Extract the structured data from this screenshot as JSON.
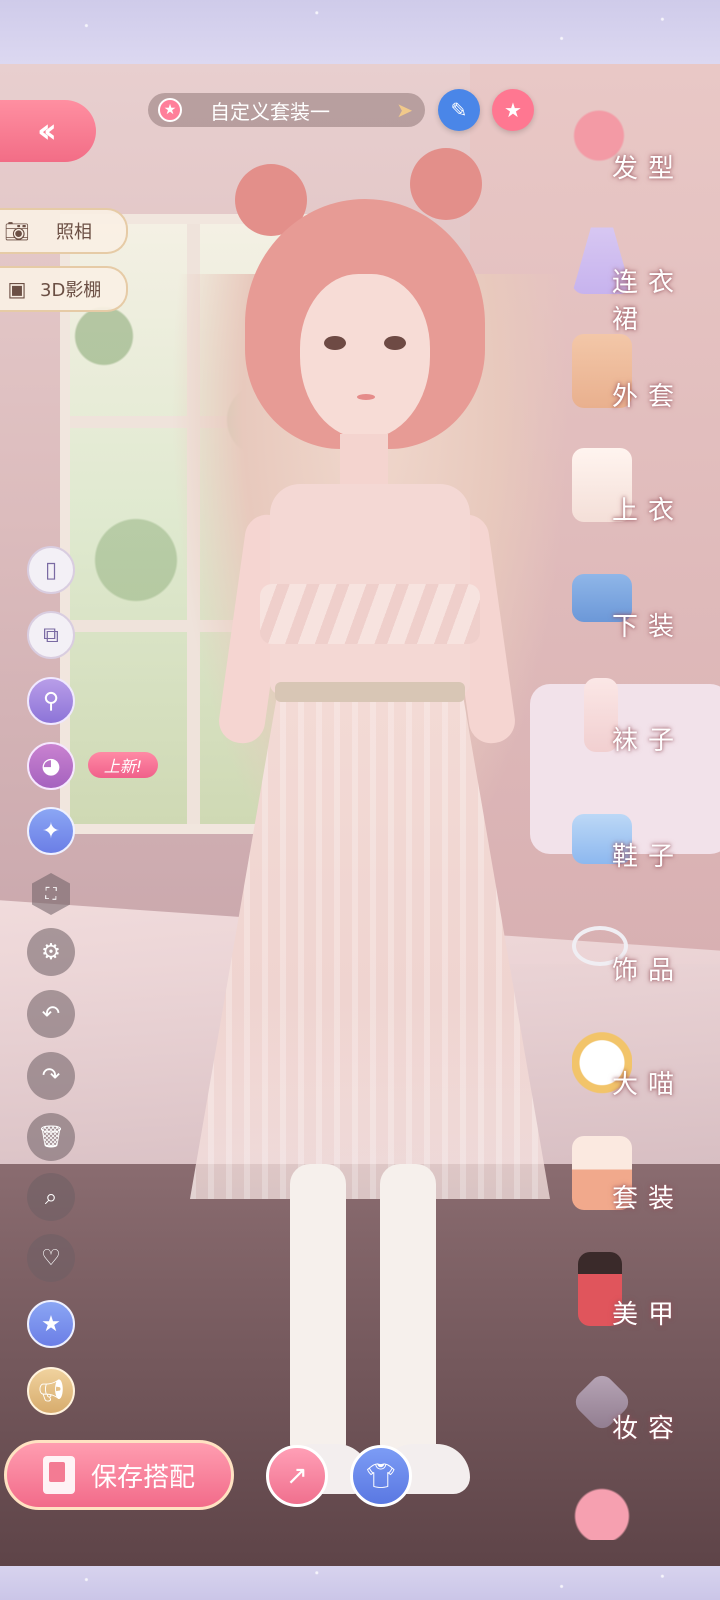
{
  "top_bar": {
    "outfit_name": "自定义套装一",
    "back_icon": "double-chevron-left-icon",
    "edit_icon": "pencil-icon",
    "favorite_icon": "star-icon"
  },
  "left_actions": {
    "photo_label": "照相",
    "studio_label": "3D影棚"
  },
  "left_tools": {
    "new_badge": "上新!",
    "icons": [
      "phone-icon",
      "add-layer-icon",
      "search-swap-icon",
      "palette-icon",
      "sparkle-star-icon",
      "fullscreen-icon",
      "settings-icon",
      "undo-icon",
      "redo-icon",
      "trash-icon",
      "search-icon",
      "heart-icon",
      "star-icon",
      "megaphone-icon"
    ]
  },
  "categories": [
    {
      "label": "发型",
      "icon": "hair-icon"
    },
    {
      "label": "连衣裙",
      "icon": "dress-icon"
    },
    {
      "label": "外套",
      "icon": "coat-icon"
    },
    {
      "label": "上衣",
      "icon": "shirt-icon"
    },
    {
      "label": "下装",
      "icon": "shorts-icon"
    },
    {
      "label": "袜子",
      "icon": "sock-icon"
    },
    {
      "label": "鞋子",
      "icon": "shoe-icon"
    },
    {
      "label": "饰品",
      "icon": "tiara-icon"
    },
    {
      "label": "大喵",
      "icon": "cat-icon"
    },
    {
      "label": "套装",
      "icon": "outfit-set-icon"
    },
    {
      "label": "美甲",
      "icon": "nail-polish-icon"
    },
    {
      "label": "妆容",
      "icon": "makeup-icon"
    }
  ],
  "bottom": {
    "save_label": "保存搭配",
    "share_icon": "share-icon",
    "outfit_icon": "outfit-icon"
  },
  "colors": {
    "accent_pink": "#f26b8a",
    "accent_blue": "#5a78e2",
    "frame_lavender": "#d9d4ee"
  }
}
